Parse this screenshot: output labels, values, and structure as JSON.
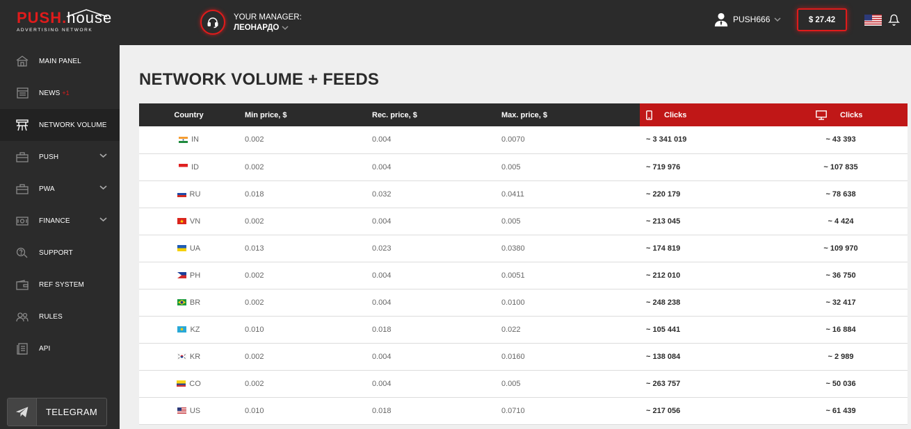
{
  "header": {
    "logo": {
      "push": "PUSH",
      "dot": ".",
      "house": "house",
      "sub": "ADVERTISING NETWORK"
    },
    "manager": {
      "label": "YOUR MANAGER:",
      "name": "ЛЕОНАРДО",
      "icon": "headset-icon"
    },
    "user": {
      "name": "PUSH666",
      "icon": "user-icon"
    },
    "balance": "$ 27.42",
    "language_icon": "us-flag-icon",
    "notifications_icon": "bell-icon"
  },
  "sidebar": {
    "items": [
      {
        "label": "MAIN PANEL",
        "icon": "home-icon",
        "badge": "",
        "has_chevron": false,
        "active": false
      },
      {
        "label": "NEWS",
        "icon": "news-icon",
        "badge": "+1",
        "has_chevron": false,
        "active": false
      },
      {
        "label": "NETWORK VOLUME",
        "icon": "network-volume-icon",
        "badge": "",
        "has_chevron": false,
        "active": true
      },
      {
        "label": "PUSH",
        "icon": "briefcase-icon",
        "badge": "",
        "has_chevron": true,
        "active": false
      },
      {
        "label": "PWA",
        "icon": "briefcase-icon",
        "badge": "",
        "has_chevron": true,
        "active": false
      },
      {
        "label": "FINANCE",
        "icon": "finance-icon",
        "badge": "",
        "has_chevron": true,
        "active": false
      },
      {
        "label": "SUPPORT",
        "icon": "support-icon",
        "badge": "",
        "has_chevron": false,
        "active": false
      },
      {
        "label": "REF SYSTEM",
        "icon": "wallet-icon",
        "badge": "",
        "has_chevron": false,
        "active": false
      },
      {
        "label": "RULES",
        "icon": "users-icon",
        "badge": "",
        "has_chevron": false,
        "active": false
      },
      {
        "label": "API",
        "icon": "document-icon",
        "badge": "",
        "has_chevron": false,
        "active": false
      }
    ],
    "telegram": {
      "label": "TELEGRAM",
      "icon": "telegram-icon"
    }
  },
  "main": {
    "title": "NETWORK VOLUME + FEEDS",
    "table": {
      "columns": {
        "country": "Country",
        "min": "Min price, $",
        "rec": "Rec. price, $",
        "max": "Max. price, $",
        "mobile": "Clicks",
        "desktop": "Clicks"
      },
      "header_colors": {
        "dark": "#2b2b2b",
        "red": "#c01717"
      },
      "rows": [
        {
          "code": "IN",
          "min": "0.002",
          "rec": "0.004",
          "max": "0.0070",
          "mobile": "~ 3 341 019",
          "desktop": "~ 43 393"
        },
        {
          "code": "ID",
          "min": "0.002",
          "rec": "0.004",
          "max": "0.005",
          "mobile": "~ 719 976",
          "desktop": "~ 107 835"
        },
        {
          "code": "RU",
          "min": "0.018",
          "rec": "0.032",
          "max": "0.0411",
          "mobile": "~ 220 179",
          "desktop": "~ 78 638"
        },
        {
          "code": "VN",
          "min": "0.002",
          "rec": "0.004",
          "max": "0.005",
          "mobile": "~ 213 045",
          "desktop": "~ 4 424"
        },
        {
          "code": "UA",
          "min": "0.013",
          "rec": "0.023",
          "max": "0.0380",
          "mobile": "~ 174 819",
          "desktop": "~ 109 970"
        },
        {
          "code": "PH",
          "min": "0.002",
          "rec": "0.004",
          "max": "0.0051",
          "mobile": "~ 212 010",
          "desktop": "~ 36 750"
        },
        {
          "code": "BR",
          "min": "0.002",
          "rec": "0.004",
          "max": "0.0100",
          "mobile": "~ 248 238",
          "desktop": "~ 32 417"
        },
        {
          "code": "KZ",
          "min": "0.010",
          "rec": "0.018",
          "max": "0.022",
          "mobile": "~ 105 441",
          "desktop": "~ 16 884"
        },
        {
          "code": "KR",
          "min": "0.002",
          "rec": "0.004",
          "max": "0.0160",
          "mobile": "~ 138 084",
          "desktop": "~ 2 989"
        },
        {
          "code": "CO",
          "min": "0.002",
          "rec": "0.004",
          "max": "0.005",
          "mobile": "~ 263 757",
          "desktop": "~ 50 036"
        },
        {
          "code": "US",
          "min": "0.010",
          "rec": "0.018",
          "max": "0.0710",
          "mobile": "~ 217 056",
          "desktop": "~ 61 439"
        }
      ]
    }
  }
}
